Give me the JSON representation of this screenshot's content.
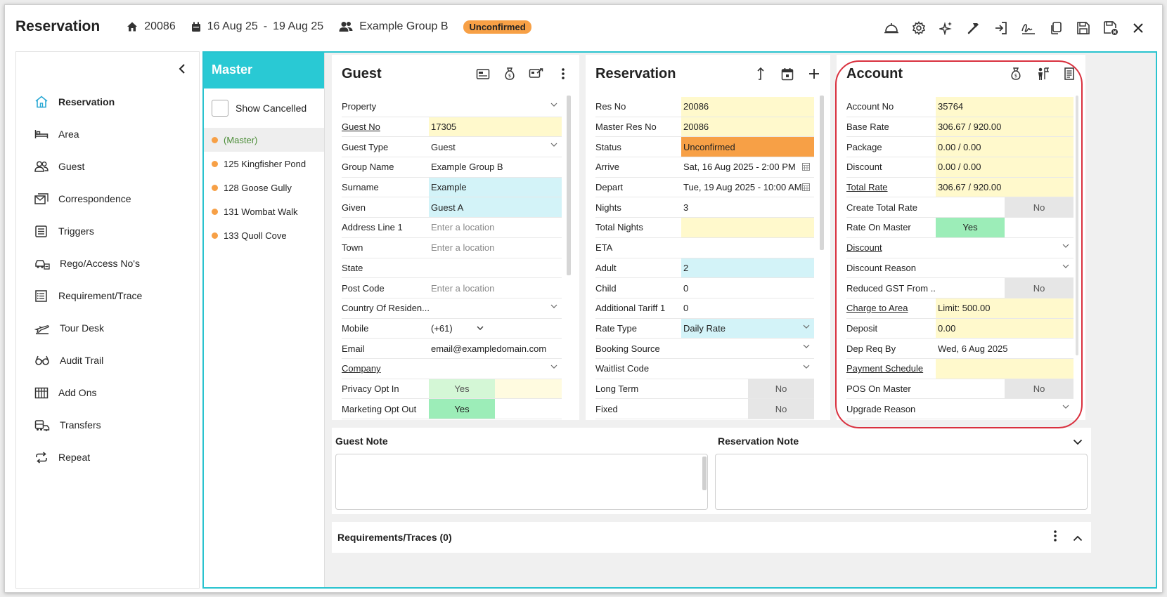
{
  "header": {
    "title": "Reservation",
    "res_no": "20086",
    "dates_from": "16 Aug 25",
    "dates_sep": "-",
    "dates_to": "19 Aug 25",
    "group": "Example Group B",
    "status": "Unconfirmed"
  },
  "sidebar": {
    "items": [
      {
        "label": "Reservation",
        "icon": "home-icon"
      },
      {
        "label": "Area",
        "icon": "bed-icon"
      },
      {
        "label": "Guest",
        "icon": "guests-icon"
      },
      {
        "label": "Correspondence",
        "icon": "mail-icon"
      },
      {
        "label": "Triggers",
        "icon": "list-icon"
      },
      {
        "label": "Rego/Access No's",
        "icon": "car-icon"
      },
      {
        "label": "Requirement/Trace",
        "icon": "checklist-icon"
      },
      {
        "label": "Tour Desk",
        "icon": "plane-icon"
      },
      {
        "label": "Audit Trail",
        "icon": "glasses-icon"
      },
      {
        "label": "Add Ons",
        "icon": "addons-icon"
      },
      {
        "label": "Transfers",
        "icon": "bus-icon"
      },
      {
        "label": "Repeat",
        "icon": "repeat-icon"
      }
    ]
  },
  "master": {
    "title": "Master",
    "show_cancelled": "Show Cancelled",
    "items": [
      "(Master)",
      "125 Kingfisher Pond",
      "128 Goose Gully",
      "131 Wombat Walk",
      "133 Quoll Cove"
    ],
    "dot_color": "#f7a046"
  },
  "guest": {
    "title": "Guest",
    "rows": {
      "property": {
        "label": "Property",
        "value": ""
      },
      "guest_no": {
        "label": "Guest No",
        "value": "17305"
      },
      "guest_type": {
        "label": "Guest Type",
        "value": "Guest"
      },
      "group_name": {
        "label": "Group Name",
        "value": "Example Group B"
      },
      "surname": {
        "label": "Surname",
        "value": "Example"
      },
      "given": {
        "label": "Given",
        "value": "Guest A"
      },
      "address": {
        "label": "Address Line 1",
        "value": "Enter a location"
      },
      "town": {
        "label": "Town",
        "value": "Enter a location"
      },
      "state": {
        "label": "State",
        "value": ""
      },
      "post_code": {
        "label": "Post Code",
        "value": "Enter a location"
      },
      "country": {
        "label": "Country Of Residen...",
        "value": ""
      },
      "mobile": {
        "label": "Mobile",
        "value": "(+61)"
      },
      "email": {
        "label": "Email",
        "value": "email@exampledomain.com"
      },
      "company": {
        "label": "Company",
        "value": ""
      },
      "privacy": {
        "label": "Privacy Opt In",
        "value": "Yes"
      },
      "marketing": {
        "label": "Marketing Opt Out",
        "value": "Yes"
      }
    }
  },
  "reservation": {
    "title": "Reservation",
    "rows": {
      "res_no": {
        "label": "Res No",
        "value": "20086"
      },
      "master_res_no": {
        "label": "Master Res No",
        "value": "20086"
      },
      "status": {
        "label": "Status",
        "value": "Unconfirmed"
      },
      "arrive": {
        "label": "Arrive",
        "value": "Sat, 16 Aug 2025 - 2:00 PM"
      },
      "depart": {
        "label": "Depart",
        "value": "Tue, 19 Aug 2025 - 10:00 AM"
      },
      "nights": {
        "label": "Nights",
        "value": "3"
      },
      "total_nights": {
        "label": "Total Nights",
        "value": ""
      },
      "eta": {
        "label": "ETA",
        "value": ""
      },
      "adult": {
        "label": "Adult",
        "value": "2"
      },
      "child": {
        "label": "Child",
        "value": "0"
      },
      "additional_tariff": {
        "label": "Additional Tariff 1",
        "value": "0"
      },
      "rate_type": {
        "label": "Rate Type",
        "value": "Daily Rate"
      },
      "booking_source": {
        "label": "Booking Source",
        "value": ""
      },
      "waitlist_code": {
        "label": "Waitlist Code",
        "value": ""
      },
      "long_term": {
        "label": "Long Term",
        "value": "No"
      },
      "fixed": {
        "label": "Fixed",
        "value": "No"
      }
    }
  },
  "account": {
    "title": "Account",
    "rows": {
      "account_no": {
        "label": "Account No",
        "value": "35764"
      },
      "base_rate": {
        "label": "Base Rate",
        "value": "306.67 / 920.00"
      },
      "package": {
        "label": "Package",
        "value": "0.00 / 0.00"
      },
      "discount_amt": {
        "label": "Discount",
        "value": "0.00 / 0.00"
      },
      "total_rate": {
        "label": "Total Rate",
        "value": "306.67 / 920.00"
      },
      "create_total_rate": {
        "label": "Create Total Rate",
        "value": "No"
      },
      "rate_on_master": {
        "label": "Rate On Master",
        "value": "Yes"
      },
      "discount": {
        "label": "Discount",
        "value": ""
      },
      "discount_reason": {
        "label": "Discount Reason",
        "value": ""
      },
      "reduced_gst": {
        "label": "Reduced GST From ...",
        "value": "No"
      },
      "charge_to_area": {
        "label": "Charge to Area",
        "value": "Limit: 500.00"
      },
      "deposit": {
        "label": "Deposit",
        "value": "0.00"
      },
      "dep_req_by": {
        "label": "Dep Req By",
        "value": "Wed, 6 Aug 2025"
      },
      "payment_schedule": {
        "label": "Payment Schedule",
        "value": ""
      },
      "pos_on_master": {
        "label": "POS On Master",
        "value": "No"
      },
      "upgrade_reason": {
        "label": "Upgrade Reason",
        "value": ""
      }
    }
  },
  "notes": {
    "guest_note": "Guest Note",
    "reservation_note": "Reservation Note"
  },
  "requirements": {
    "title": "Requirements/Traces (0)"
  },
  "colors": {
    "accent": "#29c9d4",
    "highlight": "#d9303e",
    "status": "#f7a046"
  }
}
